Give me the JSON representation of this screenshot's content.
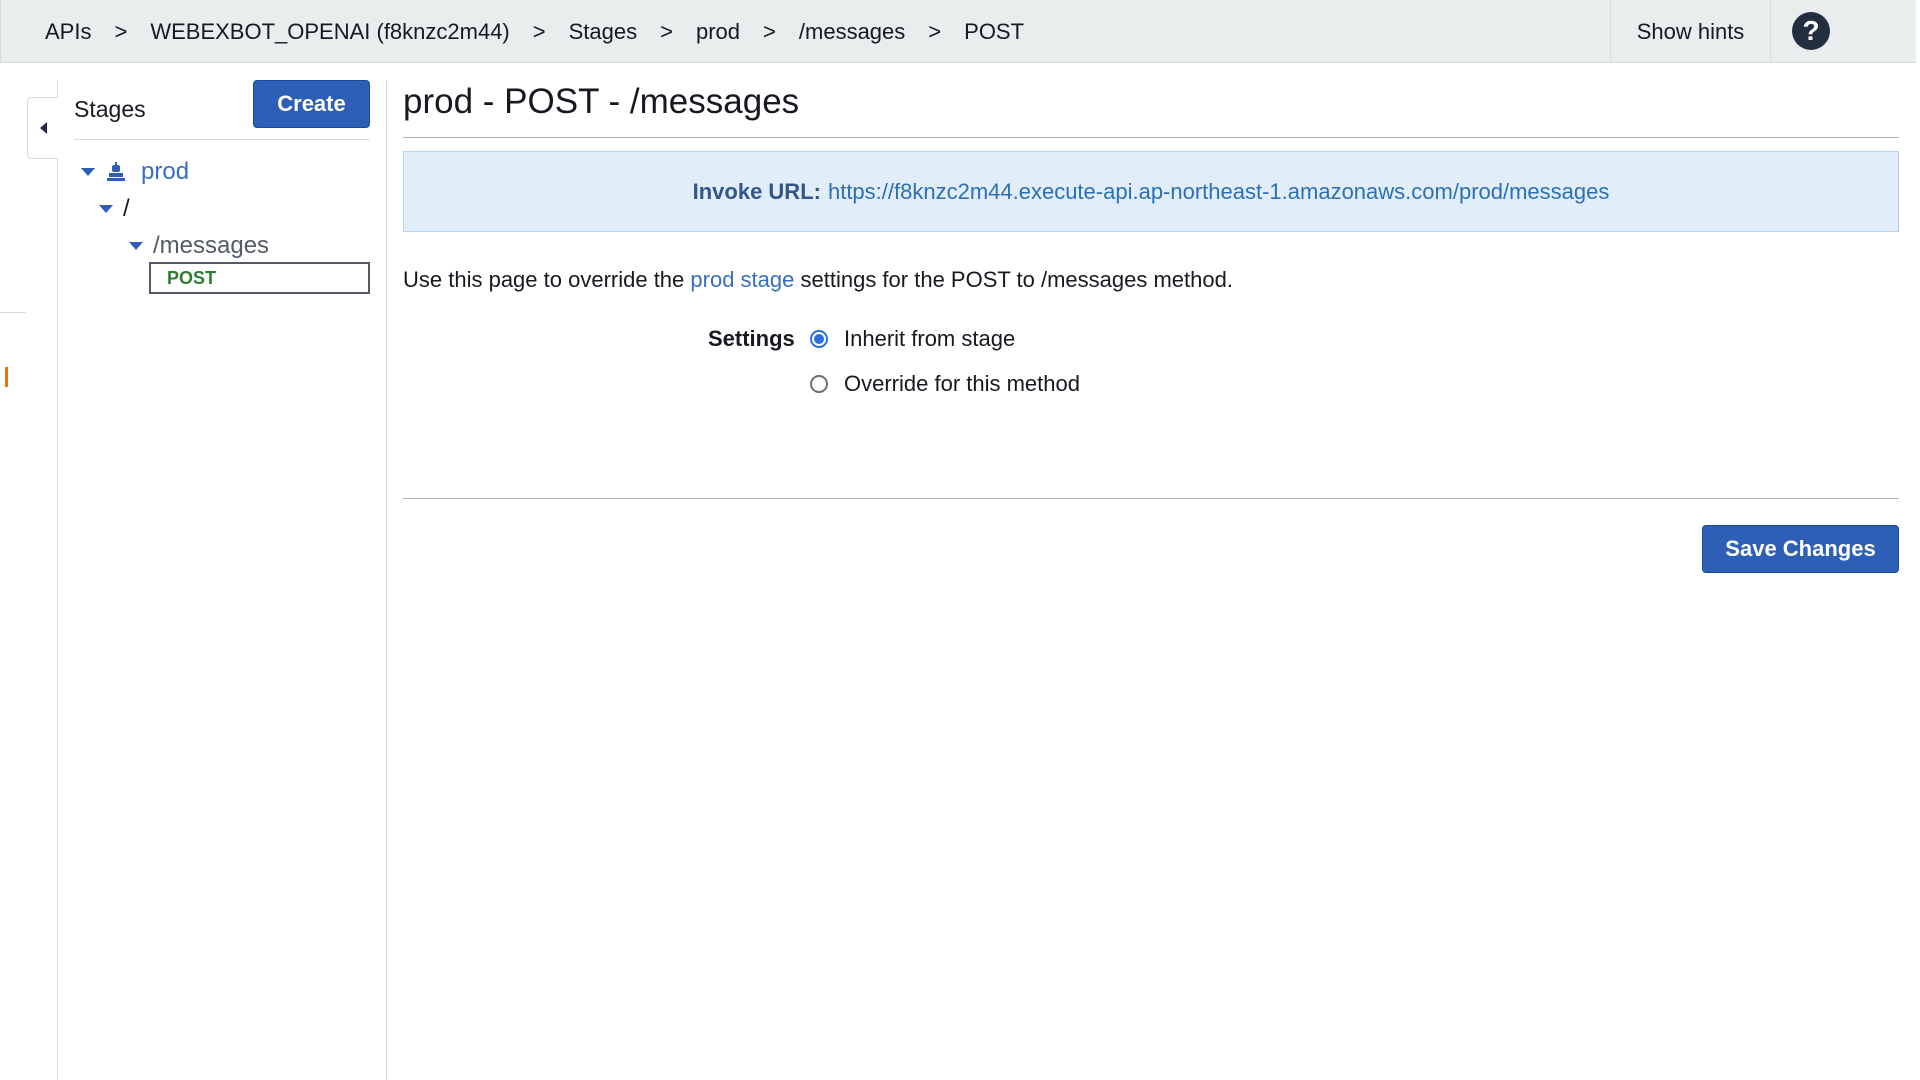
{
  "breadcrumb": {
    "items": [
      "APIs",
      "WEBEXBOT_OPENAI (f8knzc2m44)",
      "Stages",
      "prod",
      "/messages",
      "POST"
    ],
    "separator": ">"
  },
  "topbar": {
    "show_hints_label": "Show hints",
    "help_glyph": "?"
  },
  "stages_panel": {
    "title": "Stages",
    "create_label": "Create",
    "tree": {
      "stage": "prod",
      "root_resource": "/",
      "resource": "/messages",
      "method": "POST"
    }
  },
  "main": {
    "title": "prod - POST - /messages",
    "invoke_label": "Invoke URL:",
    "invoke_url": "https://f8knzc2m44.execute-api.ap-northeast-1.amazonaws.com/prod/messages",
    "desc_prefix": "Use this page to override the",
    "desc_link": "prod stage",
    "desc_suffix": "settings for the POST to /messages method.",
    "settings_label": "Settings",
    "options": [
      {
        "label": "Inherit from stage",
        "selected": true
      },
      {
        "label": "Override for this method",
        "selected": false
      }
    ],
    "save_label": "Save Changes"
  },
  "icons": {
    "stage": "stage-icon",
    "collapse": "caret-left-icon",
    "help": "help-icon",
    "expand": "caret-down-icon"
  },
  "colors": {
    "primary_button": "#2c5fb5",
    "link": "#3a6fc0",
    "invoke_bg": "#e1eefa",
    "method_green": "#2e7d32",
    "topbar_bg": "#eaeded"
  }
}
